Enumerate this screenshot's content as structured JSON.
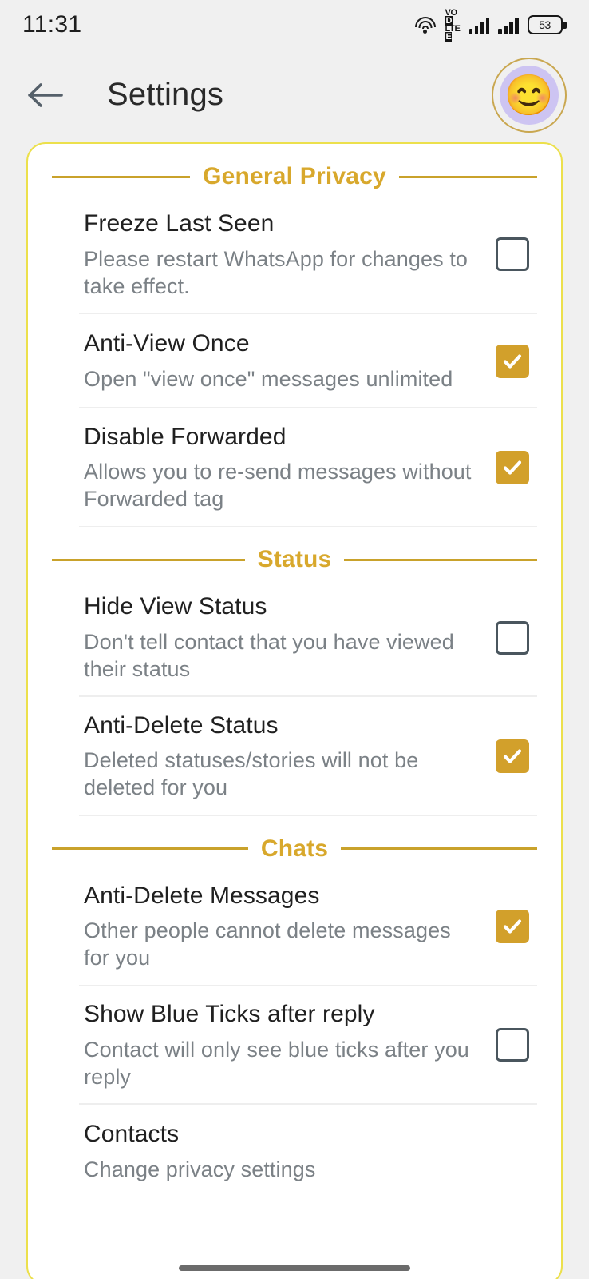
{
  "statusbar": {
    "time": "11:31",
    "wifi_icon": "wifi-icon",
    "network_label_top": "VO",
    "network_label_top_badge": "D",
    "network_label_bottom": "LTE",
    "network_label_bottom_badge": "E",
    "signal1_icon": "signal-bars-icon",
    "signal2_icon": "signal-bars-icon",
    "battery_level": "53",
    "battery_icon": "battery-icon"
  },
  "appbar": {
    "back_icon": "arrow-left-icon",
    "title": "Settings",
    "avatar_emoji": "😊",
    "avatar_name": "profile-avatar"
  },
  "colors": {
    "accent_gold": "#d8a82c",
    "rule_gold": "#c9a22b",
    "card_border": "#ece04c",
    "checkbox_on": "#d2a02b",
    "checkbox_off_border": "#4a565e",
    "title_text": "#202020",
    "subtitle_text": "#7b8186",
    "page_background": "#f0f0f0",
    "card_background": "#ffffff"
  },
  "sections": [
    {
      "label": "General Privacy",
      "items": [
        {
          "title": "Freeze Last Seen",
          "subtitle": "Please restart WhatsApp for changes to take effect.",
          "checked": false
        },
        {
          "title": "Anti-View Once",
          "subtitle": "Open \"view once\" messages unlimited",
          "checked": true
        },
        {
          "title": "Disable Forwarded",
          "subtitle": "Allows you to re-send messages without Forwarded tag",
          "checked": true
        }
      ]
    },
    {
      "label": "Status",
      "items": [
        {
          "title": "Hide View Status",
          "subtitle": "Don't tell contact that you have viewed their status",
          "checked": false
        },
        {
          "title": "Anti-Delete Status",
          "subtitle": "Deleted statuses/stories will not be deleted for you",
          "checked": true
        }
      ]
    },
    {
      "label": "Chats",
      "items": [
        {
          "title": "Anti-Delete Messages",
          "subtitle": "Other people cannot delete messages for you",
          "checked": true
        },
        {
          "title": "Show Blue Ticks after reply",
          "subtitle": "Contact will only see blue ticks after you reply",
          "checked": false
        },
        {
          "title": "Contacts",
          "subtitle": "Change privacy settings",
          "checked": null
        }
      ]
    }
  ]
}
